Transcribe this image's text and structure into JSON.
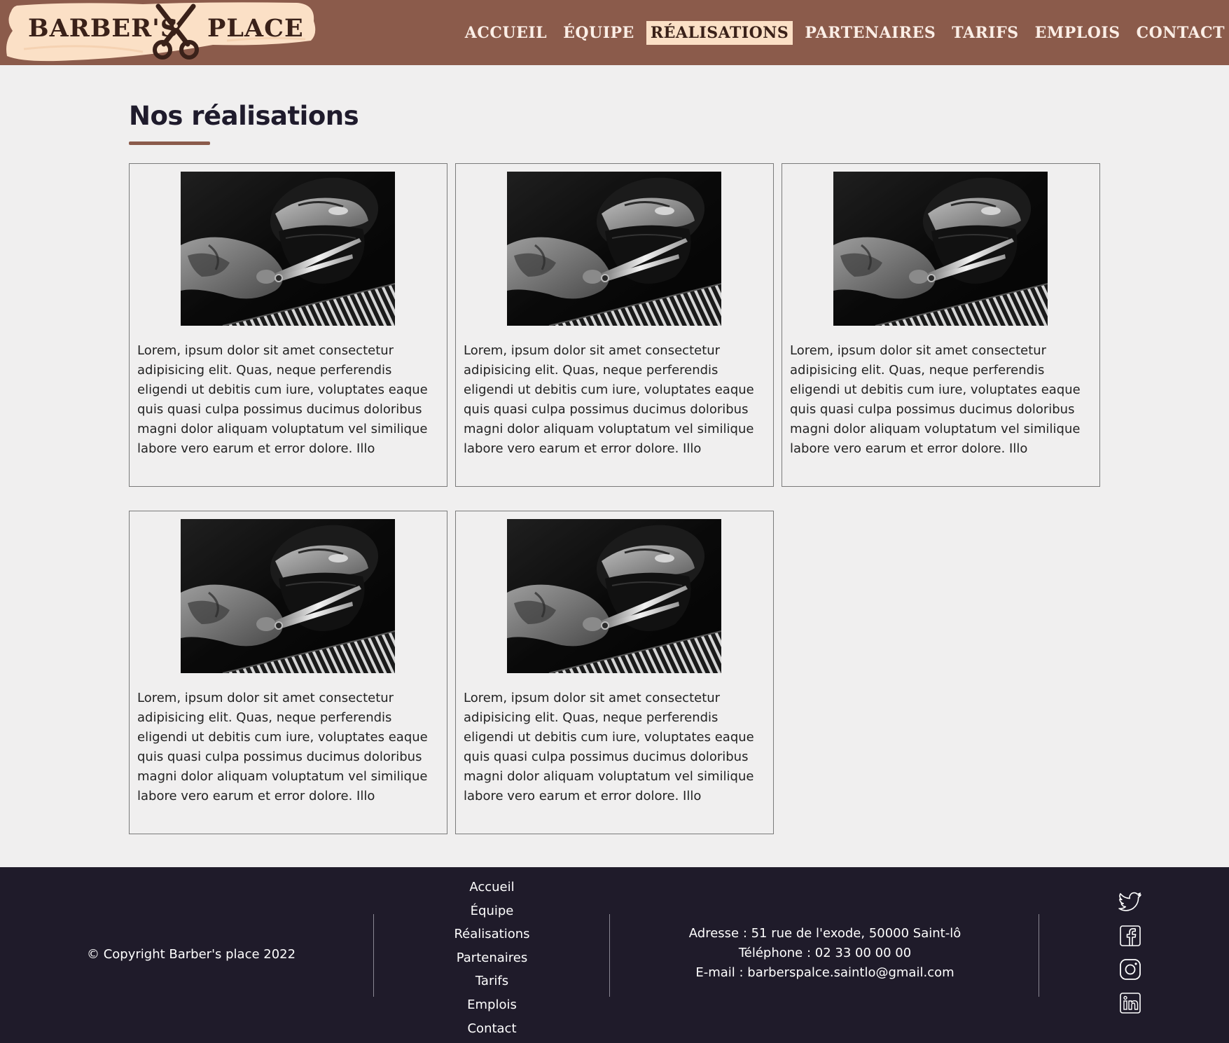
{
  "header": {
    "logo": {
      "left": "BARBER'S",
      "right": "PLACE"
    },
    "nav": [
      {
        "label": "ACCUEIL",
        "active": false
      },
      {
        "label": "ÉQUIPE",
        "active": false
      },
      {
        "label": "RÉALISATIONS",
        "active": true
      },
      {
        "label": "PARTENAIRES",
        "active": false
      },
      {
        "label": "TARIFS",
        "active": false
      },
      {
        "label": "EMPLOIS",
        "active": false
      },
      {
        "label": "CONTACT",
        "active": false
      }
    ]
  },
  "main": {
    "title": "Nos réalisations",
    "cards": [
      {
        "text": "Lorem, ipsum dolor sit amet consectetur adipisicing elit. Quas, neque perferendis eligendi ut debitis cum iure, voluptates eaque quis quasi culpa possimus ducimus doloribus magni dolor aliquam voluptatum vel similique labore vero earum et error dolore. Illo assumenda sequi excepturi, deserunt ipsa"
      },
      {
        "text": "Lorem, ipsum dolor sit amet consectetur adipisicing elit. Quas, neque perferendis eligendi ut debitis cum iure, voluptates eaque quis quasi culpa possimus ducimus doloribus magni dolor aliquam voluptatum vel similique labore vero earum et error dolore. Illo assumenda sequi excepturi, deserunt ipsa"
      },
      {
        "text": "Lorem, ipsum dolor sit amet consectetur adipisicing elit. Quas, neque perferendis eligendi ut debitis cum iure, voluptates eaque quis quasi culpa possimus ducimus doloribus magni dolor aliquam voluptatum vel similique labore vero earum et error dolore. Illo assumenda sequi excepturi, deserunt ipsa"
      },
      {
        "text": "Lorem, ipsum dolor sit amet consectetur adipisicing elit. Quas, neque perferendis eligendi ut debitis cum iure, voluptates eaque quis quasi culpa possimus ducimus doloribus magni dolor aliquam voluptatum vel similique labore vero earum et error dolore. Illo assumenda sequi excepturi, deserunt ipsa"
      },
      {
        "text": "Lorem, ipsum dolor sit amet consectetur adipisicing elit. Quas, neque perferendis eligendi ut debitis cum iure, voluptates eaque quis quasi culpa possimus ducimus doloribus magni dolor aliquam voluptatum vel similique labore vero earum et error dolore. Illo assumenda sequi excepturi, deserunt ipsa"
      }
    ]
  },
  "footer": {
    "copyright": "© Copyright Barber's place 2022",
    "links": [
      "Accueil",
      "Équipe",
      "Réalisations",
      "Partenaires",
      "Tarifs",
      "Emplois",
      "Contact"
    ],
    "address": "Adresse : 51 rue de l'exode, 50000 Saint-lô",
    "phone": "Téléphone : 02 33 00 00 00",
    "email": "E-mail : barberspalce.saintlo@gmail.com",
    "social": [
      "twitter-icon",
      "facebook-icon",
      "instagram-icon",
      "linkedin-icon"
    ]
  },
  "colors": {
    "header": "#8b5b4b",
    "accent": "#fbe0c6",
    "footer": "#1f1b2a",
    "background": "#f0efef"
  }
}
